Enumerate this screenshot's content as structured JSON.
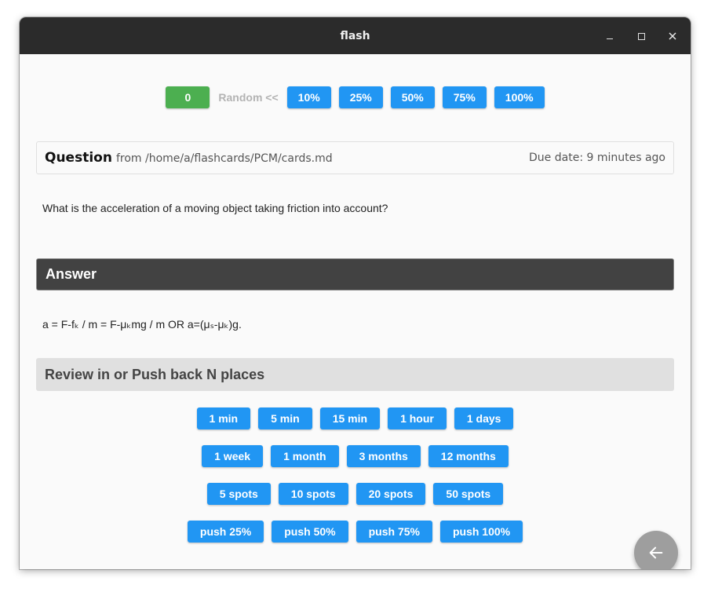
{
  "window": {
    "title": "flash"
  },
  "top_controls": {
    "counter": "0",
    "random_label": "Random <<",
    "percent_buttons": [
      "10%",
      "25%",
      "50%",
      "75%",
      "100%"
    ]
  },
  "question": {
    "title": "Question",
    "source": "from /home/a/flashcards/PCM/cards.md",
    "due": "Due date: 9 minutes ago",
    "text": "What is the acceleration of a moving object taking friction into account?"
  },
  "answer": {
    "title": "Answer",
    "text": "a = F-fₖ / m = F-μₖmg / m OR a=(μₛ-μₖ)g."
  },
  "review": {
    "title": "Review in or Push back N places",
    "time_buttons": [
      "1 min",
      "5 min",
      "15 min",
      "1 hour",
      "1 days"
    ],
    "long_buttons": [
      "1 week",
      "1 month",
      "3 months",
      "12 months"
    ],
    "spot_buttons": [
      "5 spots",
      "10 spots",
      "20 spots",
      "50 spots"
    ],
    "push_buttons": [
      "push 25%",
      "push 50%",
      "push 75%",
      "push 100%"
    ]
  },
  "fab": {
    "icon": "arrow-left-icon"
  },
  "colors": {
    "primary": "#2196f3",
    "counter": "#4caf50",
    "answer_bar": "#424242",
    "review_bar": "#e0e0e0",
    "fab": "#9e9e9e"
  }
}
